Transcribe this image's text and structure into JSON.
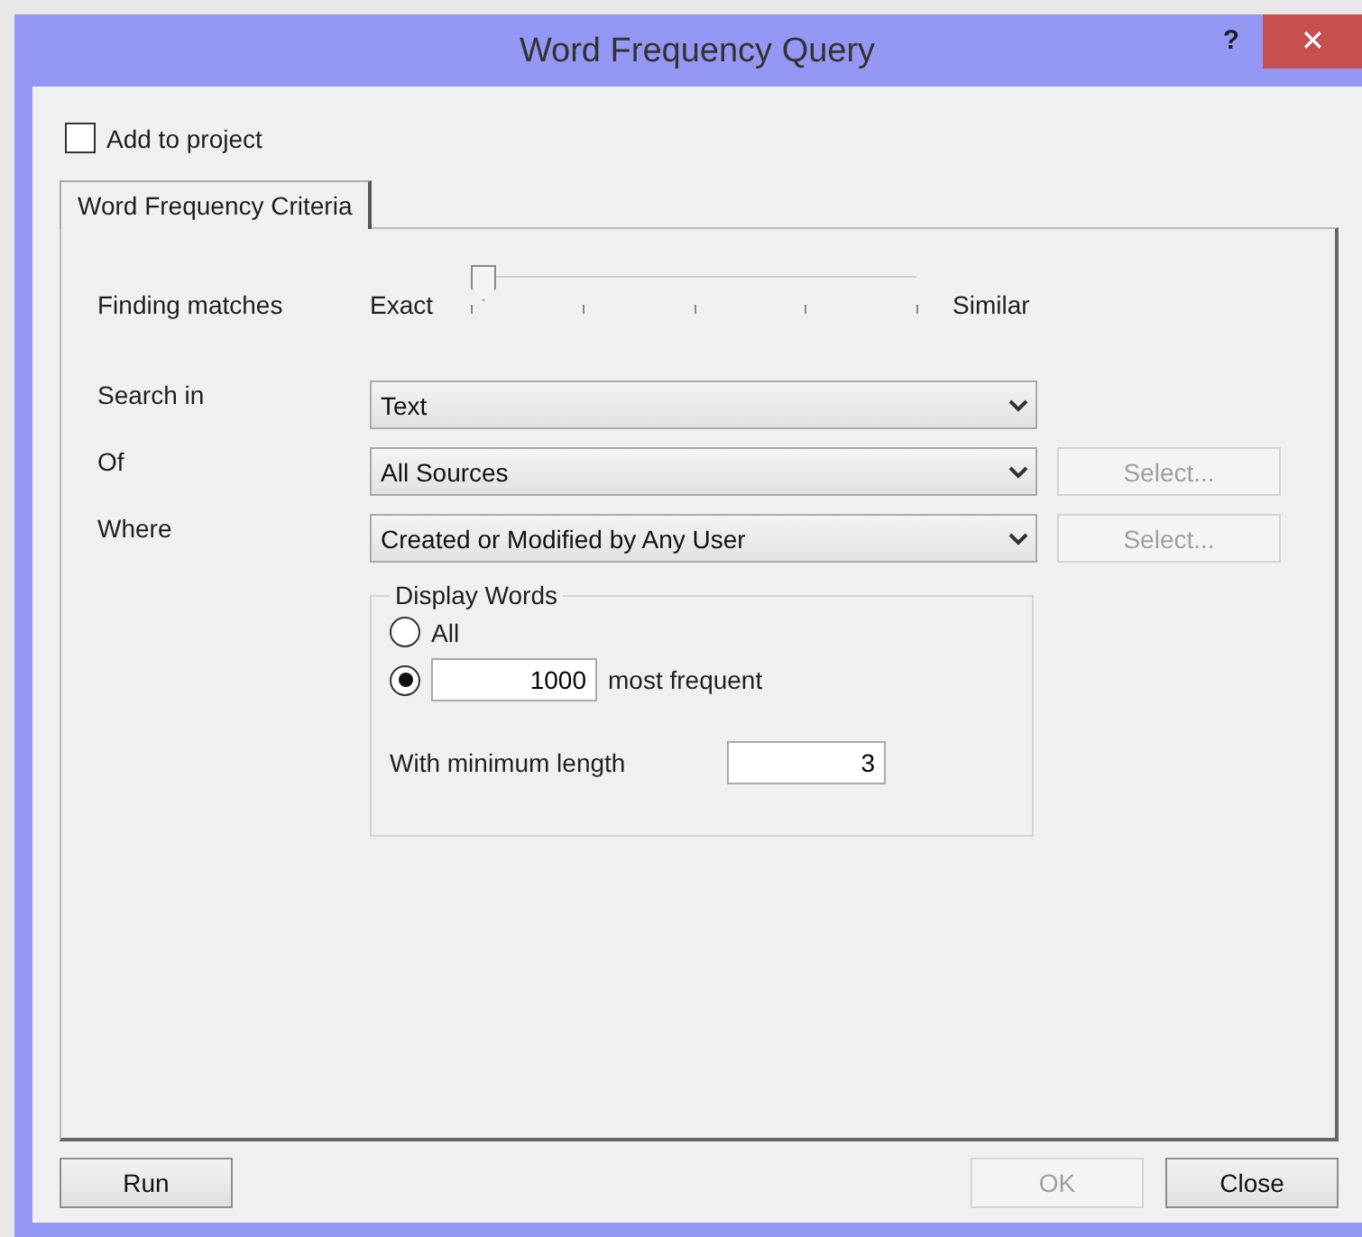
{
  "window": {
    "title": "Word Frequency Query",
    "help": "?",
    "close": "✕"
  },
  "add_to_project": {
    "label": "Add to project",
    "checked": false
  },
  "tabs": [
    {
      "label": "Word Frequency Criteria",
      "selected": true
    }
  ],
  "finding_matches": {
    "label": "Finding matches",
    "min_label": "Exact",
    "max_label": "Similar",
    "level": 0
  },
  "criteria": [
    {
      "label": "Search in",
      "value": "Text"
    },
    {
      "label": "Of",
      "value": "All Sources",
      "select_button": {
        "label": "Select...",
        "disabled": true
      }
    },
    {
      "label": "Where",
      "value": "Created or Modified by Any User",
      "select_button": {
        "label": "Select...",
        "disabled": true
      }
    }
  ],
  "display_words": {
    "title": "Display Words",
    "options": [
      {
        "label": "All",
        "selected": false
      },
      {
        "value": "1000",
        "label": "most frequent",
        "selected": true
      }
    ],
    "min_length_label": "With minimum length",
    "min_length": "3"
  },
  "left_buttons": [
    {
      "label": "Run",
      "disabled": false
    }
  ],
  "right_buttons": [
    {
      "label": "OK",
      "disabled": true
    },
    {
      "label": "Close",
      "disabled": false
    }
  ]
}
